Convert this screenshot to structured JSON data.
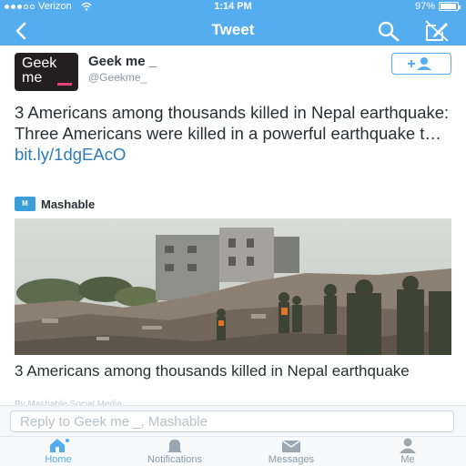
{
  "status_bar": {
    "carrier": "Verizon",
    "time": "1:14 PM",
    "battery_text": "97%",
    "battery_level": 0.97,
    "signal_bars_filled": 3
  },
  "nav": {
    "title": "Tweet",
    "back_icon": "chevron-left-icon",
    "search_icon": "search-icon",
    "compose_icon": "compose-icon"
  },
  "tweet": {
    "author_name": "Geek me _",
    "author_handle": "@Geekme_",
    "avatar_line1": "Geek",
    "avatar_line2": "me",
    "follow_icon": "add-user-icon",
    "text": "3 Americans among thousands killed in Nepal earthquake: Three Americans were killed in a powerful earthquake t… ",
    "link": "bit.ly/1dgEAcO"
  },
  "card": {
    "source_logo": "M",
    "source_name": "Mashable",
    "headline": "3 Americans among thousands killed in Nepal earthquake",
    "byline": "By Mashable Social Media"
  },
  "reply": {
    "placeholder": "Reply to Geek me _, Mashable"
  },
  "tabbar": {
    "tabs": [
      {
        "label": "Home",
        "icon": "home-icon"
      },
      {
        "label": "Notifications",
        "icon": "bell-icon"
      },
      {
        "label": "Messages",
        "icon": "envelope-icon"
      },
      {
        "label": "Me",
        "icon": "person-icon"
      }
    ]
  },
  "colors": {
    "brand": "#55acee",
    "link": "#2b7bb9",
    "avatar_accent": "#e8407e",
    "source_logo_bg": "#3a9fd8"
  }
}
